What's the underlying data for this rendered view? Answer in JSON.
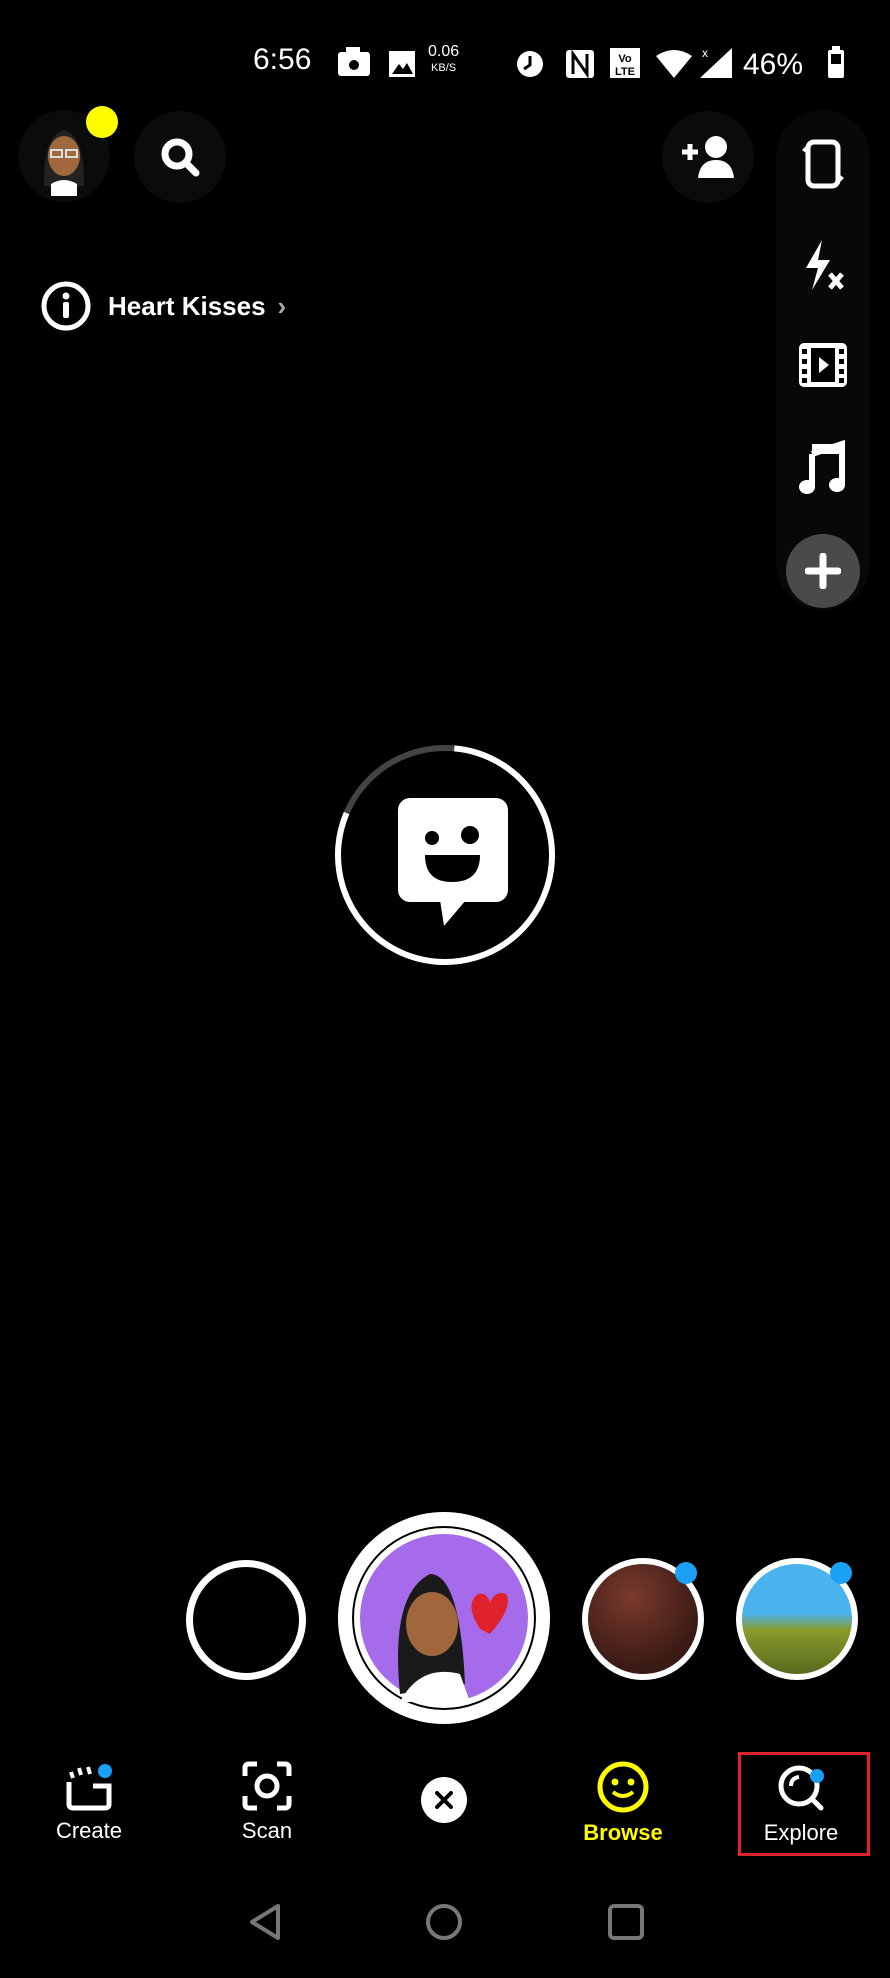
{
  "status_bar": {
    "time": "6:56",
    "net_speed_value": "0.06",
    "net_speed_unit": "KB/S",
    "battery": "46%",
    "icons": [
      "camera-icon",
      "gallery-icon",
      "alarm-icon",
      "nfc-icon",
      "volte-icon",
      "wifi-icon",
      "signal-icon",
      "battery-icon"
    ]
  },
  "top": {
    "lens_name": "Heart Kisses"
  },
  "right_toolbar": {
    "icons": [
      "flip-camera-icon",
      "flash-off-icon",
      "video-icon",
      "music-icon",
      "plus-icon"
    ]
  },
  "lens": {
    "progress": 0.8
  },
  "bottom_nav": {
    "items": [
      {
        "label": "Create"
      },
      {
        "label": "Scan"
      },
      {
        "label": "Browse"
      },
      {
        "label": "Explore"
      }
    ]
  },
  "colors": {
    "accent": "#FFFC00",
    "notification": "#1AA1F5",
    "highlight": "#E0222D",
    "purple": "#A66BEB"
  }
}
